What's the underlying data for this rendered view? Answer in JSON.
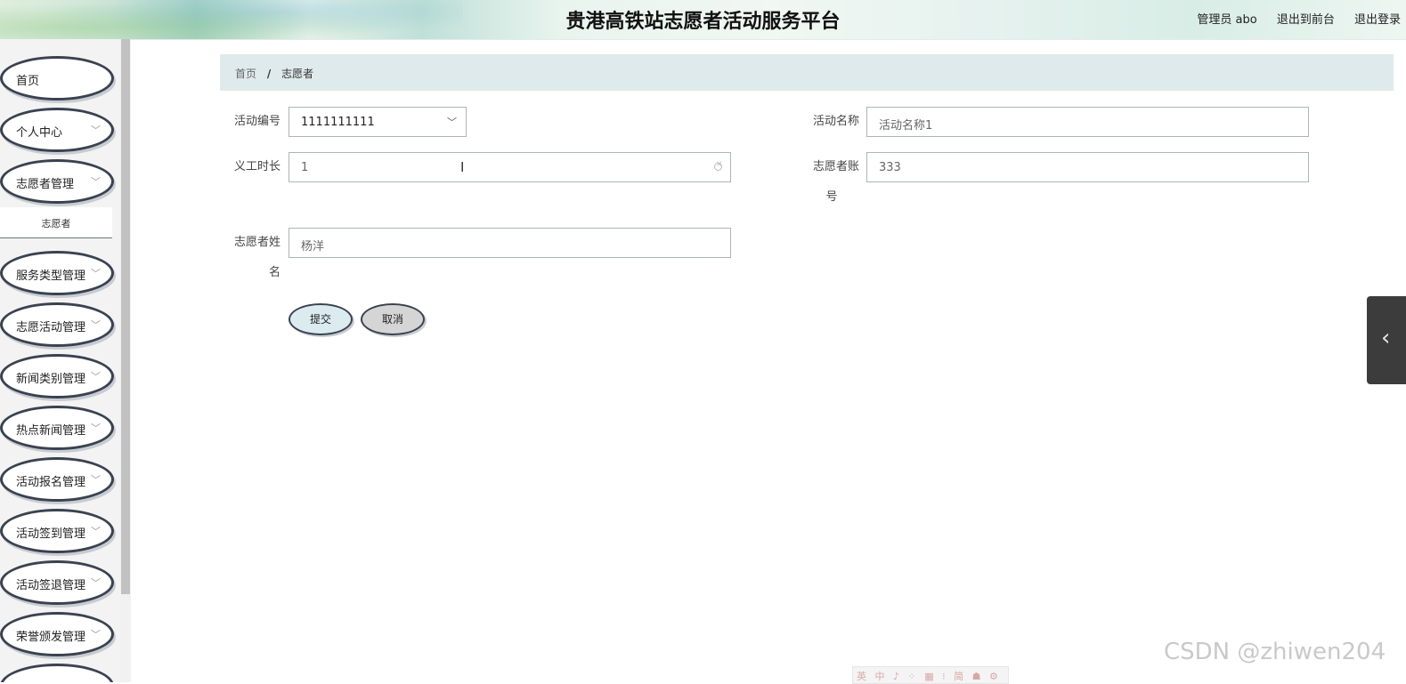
{
  "header": {
    "title": "贵港高铁站志愿者活动服务平台",
    "user_label": "管理员 abo",
    "front_link": "退出到前台",
    "logout_link": "退出登录"
  },
  "sidebar": {
    "items": [
      {
        "label": "首页"
      },
      {
        "label": "个人中心"
      },
      {
        "label": "志愿者管理"
      },
      {
        "label": "服务类型管理"
      },
      {
        "label": "志愿活动管理"
      },
      {
        "label": "新闻类别管理"
      },
      {
        "label": "热点新闻管理"
      },
      {
        "label": "活动报名管理"
      },
      {
        "label": "活动签到管理"
      },
      {
        "label": "活动签退管理"
      },
      {
        "label": "荣誉颁发管理"
      }
    ],
    "submenu_label": "志愿者",
    "chevron_icon": "chevron-down-icon"
  },
  "breadcrumb": {
    "home": "首页",
    "separator": "/",
    "current": "志愿者"
  },
  "form": {
    "activity_no_label": "活动编号",
    "activity_no_value": "1111111111",
    "activity_name_label": "活动名称",
    "activity_name_value": "活动名称1",
    "hours_label": "义工时长",
    "hours_value": "1",
    "account_label_1": "志愿者账",
    "account_label_2": "号",
    "account_value": "333",
    "name_label_1": "志愿者姓",
    "name_label_2": "名",
    "name_value": "杨洋",
    "submit_label": "提交",
    "cancel_label": "取消"
  },
  "watermark": "CSDN @zhiwen204",
  "toolbar_strip": "英 中 ♪ ⁘ ▦ ⁝ 简 ☗ ⚙"
}
